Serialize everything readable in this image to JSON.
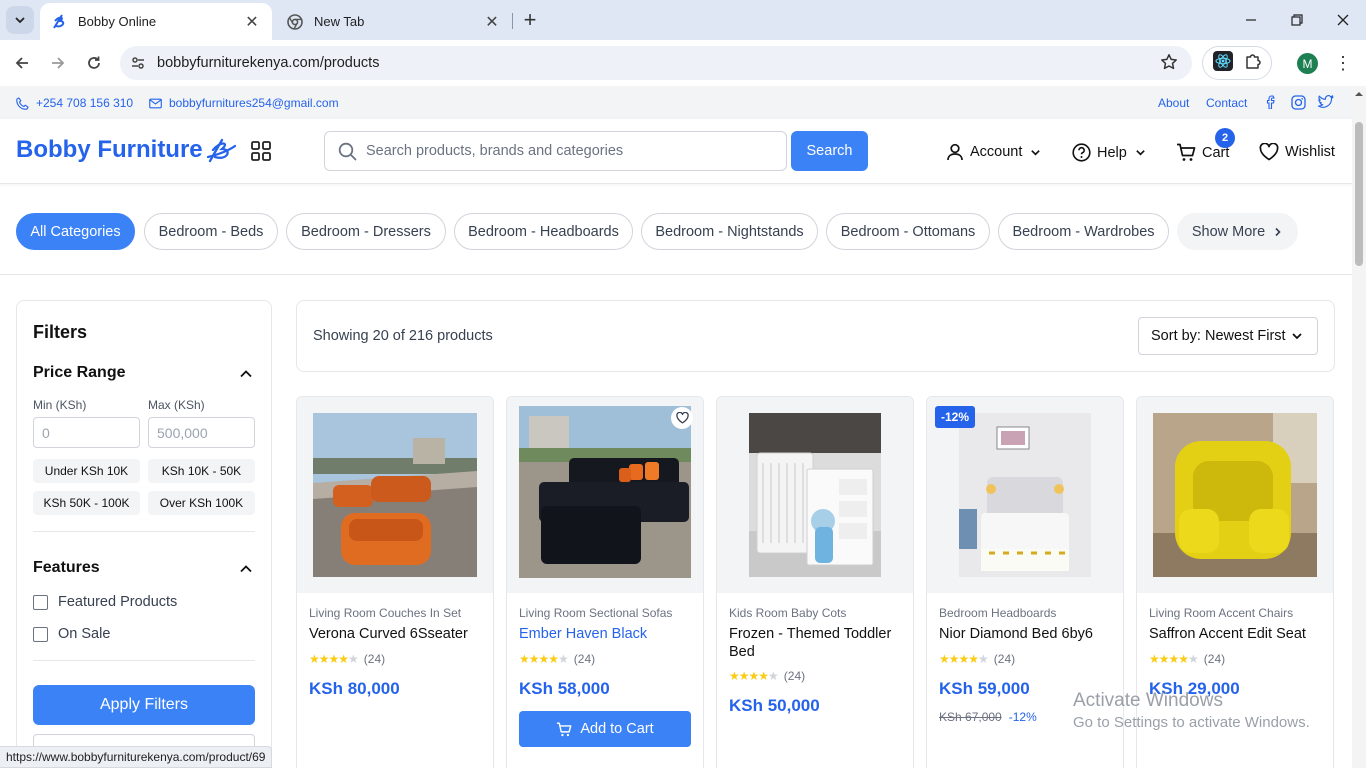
{
  "browser": {
    "tabs": [
      {
        "title": "Bobby Online",
        "active": true
      },
      {
        "title": "New Tab",
        "active": false
      }
    ],
    "url": "bobbyfurniturekenya.com/products",
    "profile_initial": "M",
    "status_url": "https://www.bobbyfurniturekenya.com/product/69"
  },
  "topbar": {
    "phone": "+254 708 156 310",
    "email": "bobbyfurnitures254@gmail.com",
    "links": [
      "About",
      "Contact"
    ]
  },
  "header": {
    "logo": "Bobby Furniture",
    "search_placeholder": "Search products, brands and categories",
    "search_button": "Search",
    "account": "Account",
    "help": "Help",
    "cart": "Cart",
    "cart_count": "2",
    "wishlist": "Wishlist"
  },
  "categories": [
    "All Categories",
    "Bedroom - Beds",
    "Bedroom - Dressers",
    "Bedroom - Headboards",
    "Bedroom - Nightstands",
    "Bedroom - Ottomans",
    "Bedroom - Wardrobes",
    "Show More"
  ],
  "filters": {
    "title": "Filters",
    "price_range": {
      "title": "Price Range",
      "min_label": "Min (KSh)",
      "max_label": "Max (KSh)",
      "min_placeholder": "0",
      "max_placeholder": "500,000",
      "presets": [
        "Under KSh 10K",
        "KSh 10K - 50K",
        "KSh 50K - 100K",
        "Over KSh 100K"
      ]
    },
    "features": {
      "title": "Features",
      "options": [
        "Featured Products",
        "On Sale"
      ]
    },
    "apply": "Apply Filters"
  },
  "results": {
    "count_text": "Showing 20 of 216 products",
    "sort": "Sort by: Newest First"
  },
  "products": [
    {
      "category": "Living Room Couches In Set",
      "name": "Verona Curved 6Sseater",
      "rating": 4,
      "reviews": "(24)",
      "price": "KSh 80,000"
    },
    {
      "category": "Living Room Sectional Sofas",
      "name": "Ember Haven Black",
      "rating": 4,
      "reviews": "(24)",
      "price": "KSh 58,000",
      "add_to_cart": "Add to Cart"
    },
    {
      "category": "Kids Room Baby Cots",
      "name": "Frozen - Themed Toddler Bed",
      "rating": 4,
      "reviews": "(24)",
      "price": "KSh 50,000"
    },
    {
      "category": "Bedroom Headboards",
      "name": "Nior Diamond Bed 6by6",
      "rating": 4,
      "reviews": "(24)",
      "price": "KSh 59,000",
      "badge": "-12%",
      "old_price": "KSh 67,000",
      "discount": "-12%"
    },
    {
      "category": "Living Room Accent Chairs",
      "name": "Saffron Accent Edit Seat",
      "rating": 4,
      "reviews": "(24)",
      "price": "KSh 29,000"
    }
  ],
  "watermark": {
    "line1": "Activate Windows",
    "line2": "Go to Settings to activate Windows."
  },
  "colors": {
    "primary": "#3b82f6",
    "brand": "#2563eb"
  }
}
